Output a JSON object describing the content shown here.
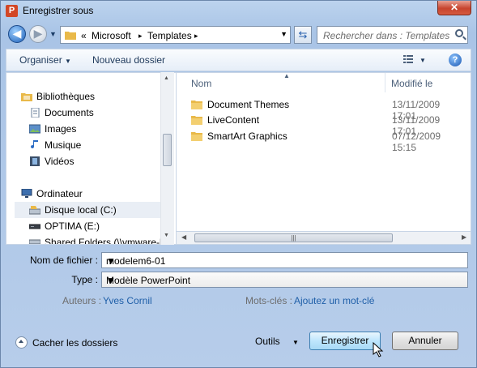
{
  "window": {
    "title": "Enregistrer sous",
    "app_icon_letter": "P",
    "close_glyph": "✕"
  },
  "address": {
    "prefix": "«",
    "crumbs": [
      "Microsoft",
      "Templates"
    ],
    "separator": "▸",
    "search_placeholder": "Rechercher dans : Templates"
  },
  "toolbar": {
    "organize": "Organiser",
    "new_folder": "Nouveau dossier",
    "help_glyph": "?"
  },
  "nav": {
    "libraries": "Bibliothèques",
    "documents": "Documents",
    "images": "Images",
    "music": "Musique",
    "videos": "Vidéos",
    "computer": "Ordinateur",
    "local_disk": "Disque local (C:)",
    "optima": "OPTIMA (E:)",
    "shared": "Shared Folders (\\\\vmware-ho"
  },
  "files": {
    "col_name": "Nom",
    "col_modified": "Modifié le",
    "rows": [
      {
        "name": "Document Themes",
        "date": "13/11/2009 17:01"
      },
      {
        "name": "LiveContent",
        "date": "13/11/2009 17:01"
      },
      {
        "name": "SmartArt Graphics",
        "date": "07/12/2009 15:15"
      }
    ]
  },
  "form": {
    "filename_label": "Nom de fichier :",
    "filename_value": "modelem6-01",
    "type_label": "Type :",
    "type_value": "Modèle PowerPoint",
    "authors_label": "Auteurs :",
    "authors_value": "Yves Cornil",
    "keywords_label": "Mots-clés :",
    "keywords_value": "Ajoutez un mot-clé"
  },
  "footer": {
    "hide_folders": "Cacher les dossiers",
    "tools": "Outils",
    "save": "Enregistrer",
    "cancel": "Annuler"
  },
  "colors": {
    "folder": "#e9b949",
    "link": "#1f5fa8",
    "title_bg": "#bcd3ee"
  }
}
